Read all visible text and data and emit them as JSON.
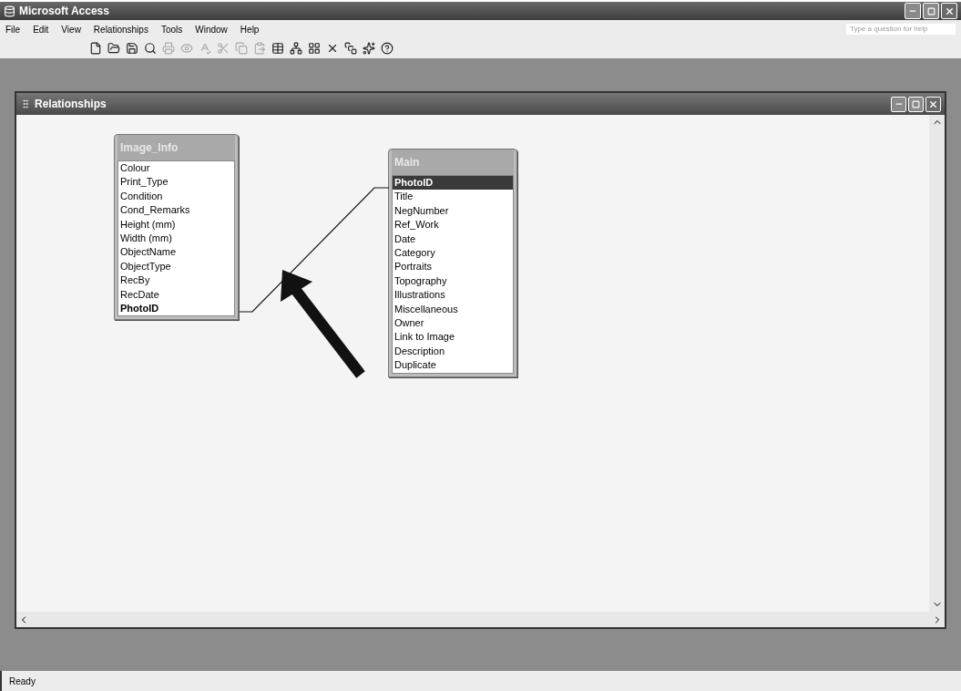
{
  "window": {
    "title": "Microsoft Access"
  },
  "menu": [
    "File",
    "Edit",
    "View",
    "Relationships",
    "Tools",
    "Window",
    "Help"
  ],
  "help_box": {
    "placeholder": "Type a question for help"
  },
  "child_window": {
    "title": "Relationships"
  },
  "tables": [
    {
      "title": "Image_Info",
      "fields": [
        {
          "name": "Colour",
          "key": false,
          "selected": false
        },
        {
          "name": "Print_Type",
          "key": false,
          "selected": false
        },
        {
          "name": "Condition",
          "key": false,
          "selected": false
        },
        {
          "name": "Cond_Remarks",
          "key": false,
          "selected": false
        },
        {
          "name": "Height (mm)",
          "key": false,
          "selected": false
        },
        {
          "name": "Width (mm)",
          "key": false,
          "selected": false
        },
        {
          "name": "ObjectName",
          "key": false,
          "selected": false
        },
        {
          "name": "ObjectType",
          "key": false,
          "selected": false
        },
        {
          "name": "RecBy",
          "key": false,
          "selected": false
        },
        {
          "name": "RecDate",
          "key": false,
          "selected": false
        },
        {
          "name": "PhotoID",
          "key": true,
          "selected": false
        }
      ]
    },
    {
      "title": "Main",
      "fields": [
        {
          "name": "PhotoID",
          "key": true,
          "selected": true
        },
        {
          "name": "Title",
          "key": false,
          "selected": false
        },
        {
          "name": "NegNumber",
          "key": false,
          "selected": false
        },
        {
          "name": "Ref_Work",
          "key": false,
          "selected": false
        },
        {
          "name": "Date",
          "key": false,
          "selected": false
        },
        {
          "name": "Category",
          "key": false,
          "selected": false
        },
        {
          "name": "Portraits",
          "key": false,
          "selected": false
        },
        {
          "name": "Topography",
          "key": false,
          "selected": false
        },
        {
          "name": "Illustrations",
          "key": false,
          "selected": false
        },
        {
          "name": "Miscellaneous",
          "key": false,
          "selected": false
        },
        {
          "name": "Owner",
          "key": false,
          "selected": false
        },
        {
          "name": "Link to Image",
          "key": false,
          "selected": false
        },
        {
          "name": "Description",
          "key": false,
          "selected": false
        },
        {
          "name": "Duplicate",
          "key": false,
          "selected": false
        }
      ]
    }
  ],
  "status_bar": "Ready"
}
